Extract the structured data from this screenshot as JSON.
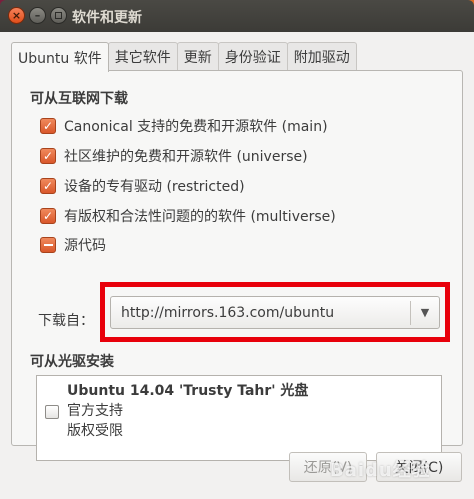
{
  "window": {
    "title": "软件和更新",
    "close_glyph": "×",
    "min_glyph": "–"
  },
  "tabs": [
    {
      "label": "Ubuntu 软件",
      "active": true
    },
    {
      "label": "其它软件",
      "active": false
    },
    {
      "label": "更新",
      "active": false
    },
    {
      "label": "身份验证",
      "active": false
    },
    {
      "label": "附加驱动",
      "active": false
    }
  ],
  "internet": {
    "title": "可从互联网下载",
    "items": [
      {
        "label": "Canonical 支持的免费和开源软件 (main)",
        "state": "checked"
      },
      {
        "label": "社区维护的免费和开源软件 (universe)",
        "state": "checked"
      },
      {
        "label": "设备的专有驱动 (restricted)",
        "state": "checked"
      },
      {
        "label": "有版权和合法性问题的的软件 (multiverse)",
        "state": "checked"
      },
      {
        "label": "源代码",
        "state": "partial"
      }
    ],
    "download_from_label": "下载自：",
    "download_from_value": "http://mirrors.163.com/ubuntu"
  },
  "cdrom": {
    "title": "可从光驱安装",
    "disc_title": "Ubuntu 14.04 'Trusty Tahr' 光盘",
    "line1": "官方支持",
    "line2": "版权受限"
  },
  "buttons": {
    "revert": "还原(V)",
    "close": "关闭(C)"
  },
  "watermark": "Baidu经验",
  "colors": {
    "accent": "#dd4814",
    "highlight": "#e8000b"
  }
}
